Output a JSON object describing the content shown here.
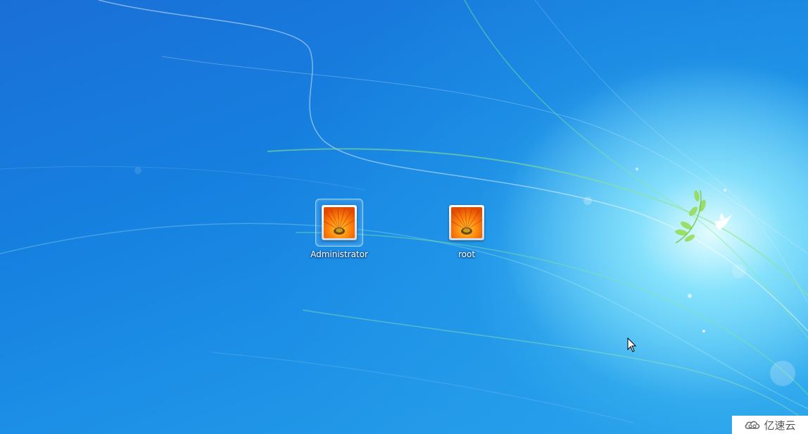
{
  "screen": {
    "type": "Windows 7 login user selection",
    "background_color": "#1a7ad9"
  },
  "users": [
    {
      "name": "Administrator",
      "selected": true,
      "picture_icon": "orange-flower-icon"
    },
    {
      "name": "root",
      "selected": false,
      "picture_icon": "orange-flower-icon"
    }
  ],
  "cursor": {
    "icon": "arrow-cursor-icon"
  },
  "watermark": {
    "text": "亿速云",
    "icon": "cloud-logo-icon"
  }
}
